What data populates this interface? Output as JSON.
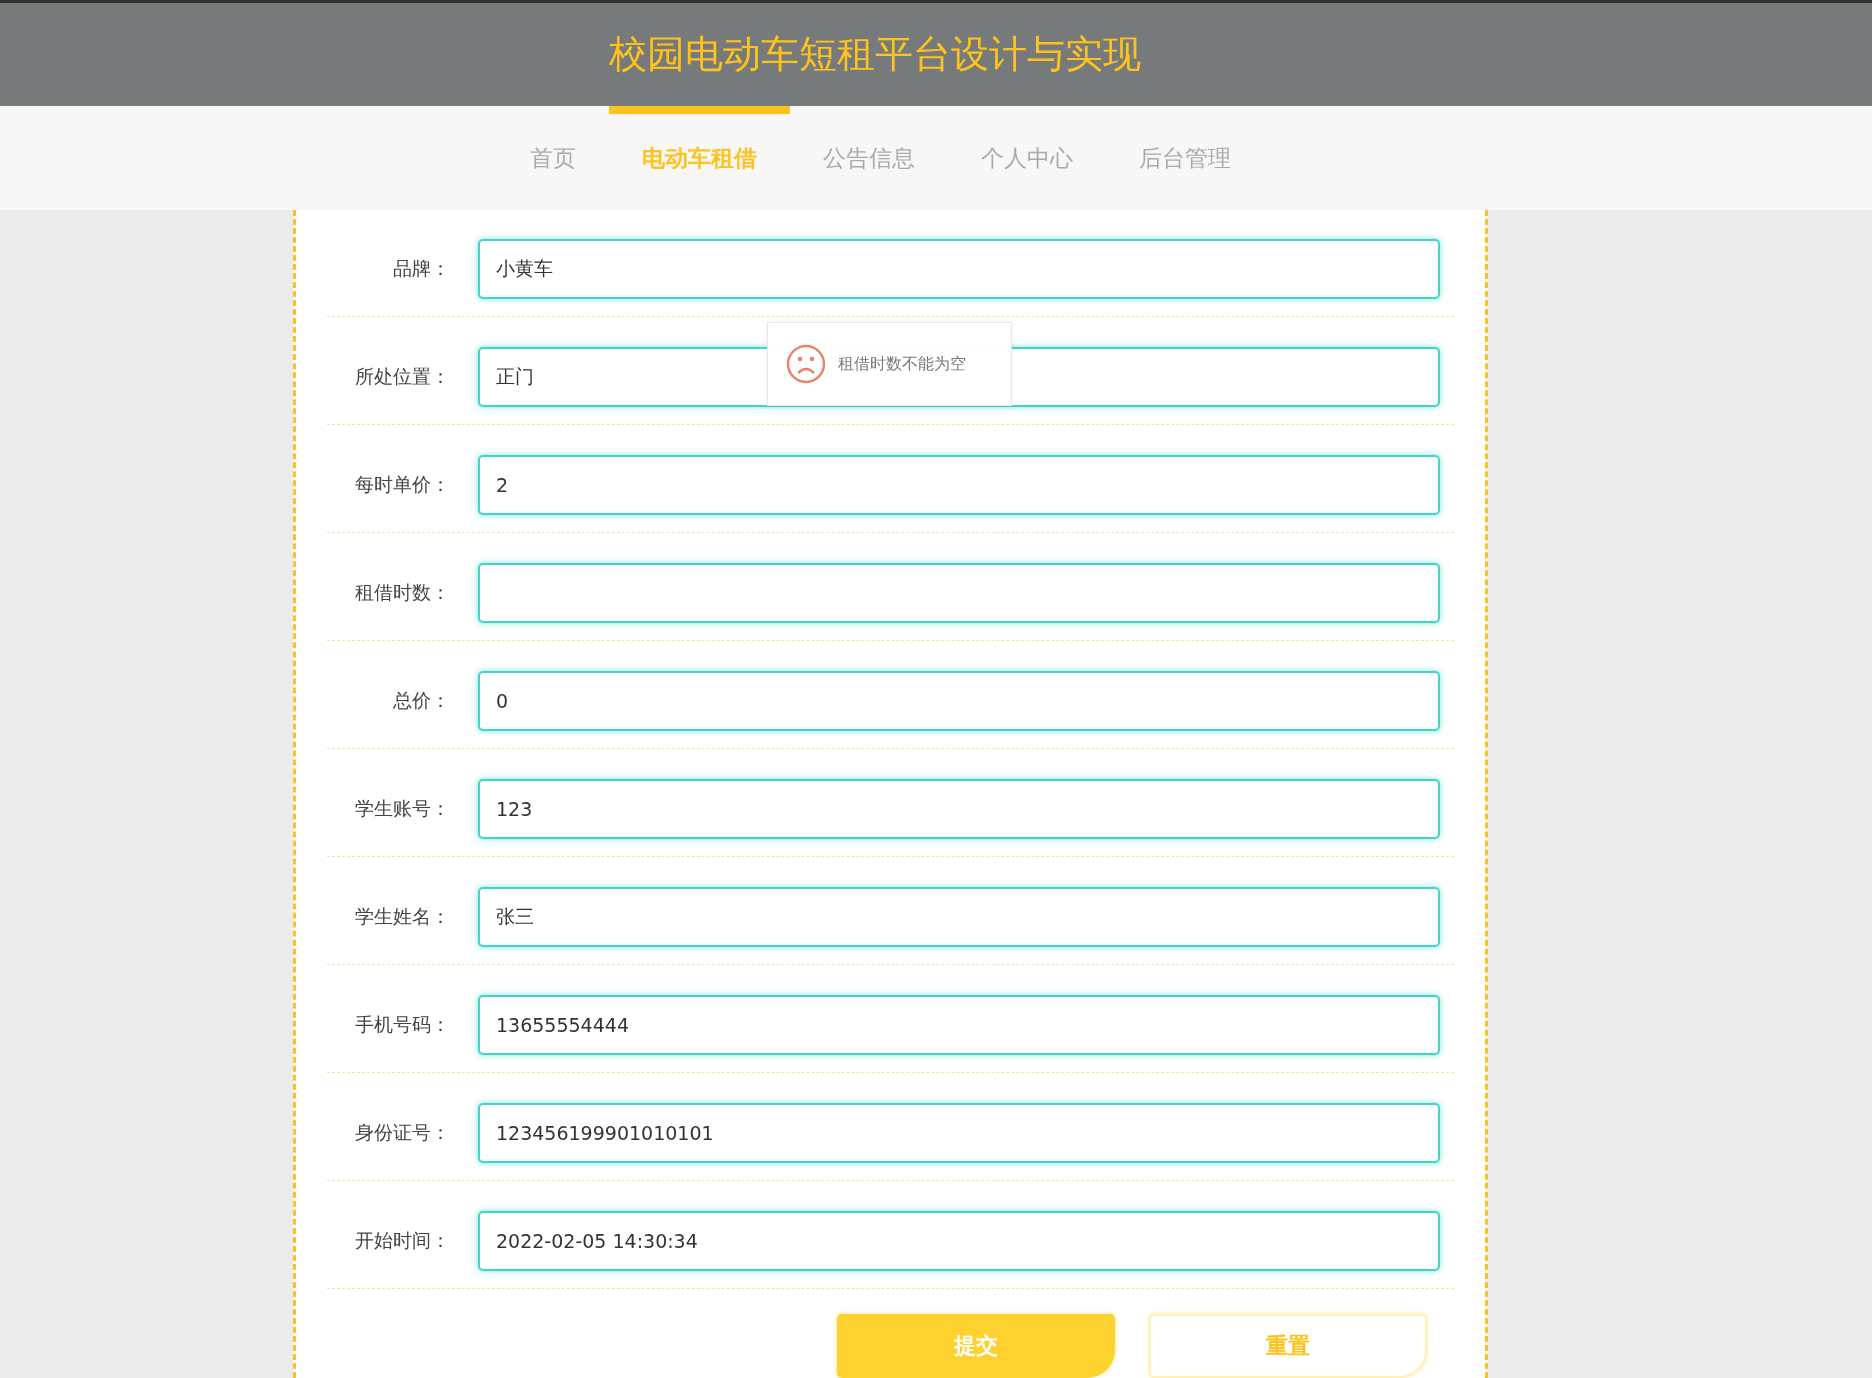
{
  "header": {
    "title": "校园电动车短租平台设计与实现"
  },
  "nav": [
    {
      "label": "首页",
      "selected": false
    },
    {
      "label": "电动车租借",
      "selected": true
    },
    {
      "label": "公告信息",
      "selected": false
    },
    {
      "label": "个人中心",
      "selected": false
    },
    {
      "label": "后台管理",
      "selected": false
    }
  ],
  "form": {
    "fields": [
      {
        "label": "品牌：",
        "value": "小黄车"
      },
      {
        "label": "所处位置：",
        "value": "正门"
      },
      {
        "label": "每时单价：",
        "value": "2"
      },
      {
        "label": "租借时数："
      },
      {
        "label": "总价：",
        "value": "0"
      },
      {
        "label": "学生账号：",
        "value": "123"
      },
      {
        "label": "学生姓名：",
        "value": "张三"
      },
      {
        "label": "手机号码：",
        "value": "13655554444"
      },
      {
        "label": "身份证号：",
        "value": "123456199901010101"
      },
      {
        "label": "开始时间：",
        "value": "2022-02-05 14:30:34"
      }
    ],
    "buttons": [
      {
        "label": "提交",
        "kind": "primary"
      },
      {
        "label": "重置",
        "kind": "secondary"
      }
    ]
  },
  "toast": {
    "message": "租借时数不能为空"
  }
}
